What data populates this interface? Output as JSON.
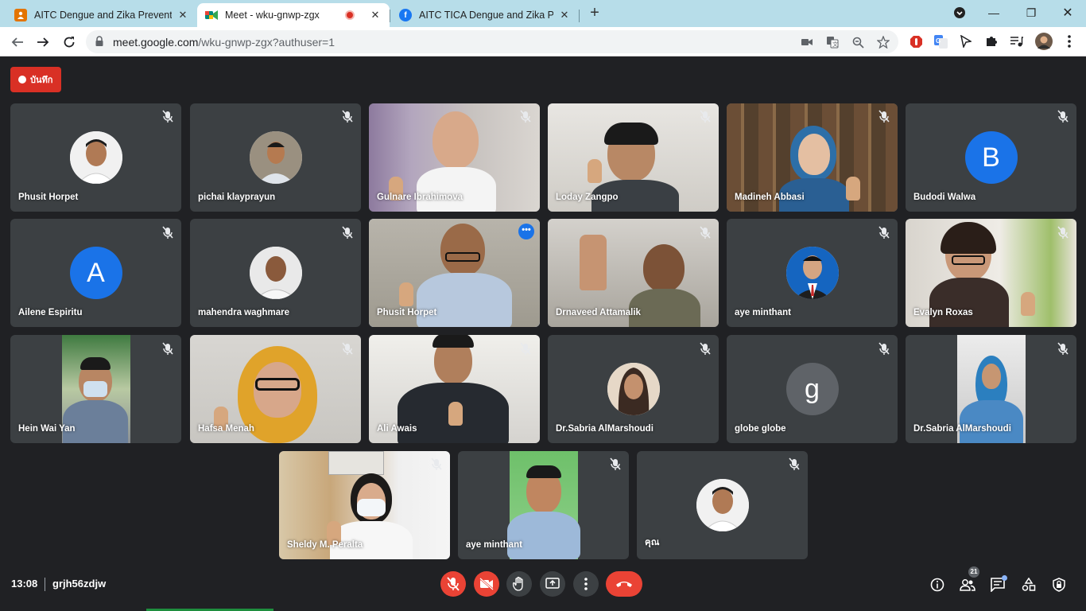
{
  "browser": {
    "tabs": [
      {
        "title": "AITC Dengue and Zika Prevention",
        "favicon": "person-icon",
        "color": "#e37400"
      },
      {
        "title": "Meet - wku-gnwp-zgx",
        "favicon": "meet-icon",
        "color": "#00897b",
        "recording": true
      },
      {
        "title": "AITC TICA Dengue and Zika Prev",
        "favicon": "facebook-icon",
        "color": "#1877f2"
      }
    ],
    "url_host": "meet.google.com",
    "url_path": "/wku-gnwp-zgx?authuser=1"
  },
  "meet": {
    "recording_label": "บันทึก",
    "tiles": [
      {
        "name": "Phusit Horpet",
        "kind": "avatar-photo"
      },
      {
        "name": "pichai klayprayun",
        "kind": "avatar-photo"
      },
      {
        "name": "Gulnare Ibrahimova",
        "kind": "video"
      },
      {
        "name": "Loday Zangpo",
        "kind": "video"
      },
      {
        "name": "Madineh Abbasi",
        "kind": "video"
      },
      {
        "name": "Budodi Walwa",
        "kind": "avatar-letter",
        "letter": "B",
        "color": "#1a73e8"
      },
      {
        "name": "Ailene Espiritu",
        "kind": "avatar-letter",
        "letter": "A",
        "color": "#1a73e8"
      },
      {
        "name": "mahendra waghmare",
        "kind": "avatar-photo"
      },
      {
        "name": "Phusit Horpet",
        "kind": "video",
        "speaking": true
      },
      {
        "name": "Drnaveed Attamalik",
        "kind": "video"
      },
      {
        "name": "aye minthant",
        "kind": "avatar-photo"
      },
      {
        "name": "Evalyn Roxas",
        "kind": "video"
      },
      {
        "name": "Hein Wai Yan",
        "kind": "video"
      },
      {
        "name": "Hafsa Menah",
        "kind": "video"
      },
      {
        "name": "Ali Awais",
        "kind": "video"
      },
      {
        "name": "Dr.Sabria AlMarshoudi",
        "kind": "avatar-photo"
      },
      {
        "name": "globe globe",
        "kind": "avatar-letter",
        "letter": "g",
        "color": "#5f6368"
      },
      {
        "name": "Dr.Sabria AlMarshoudi",
        "kind": "video"
      },
      {
        "name": "Sheldy M. Peralta",
        "kind": "video"
      },
      {
        "name": "aye minthant",
        "kind": "video"
      },
      {
        "name": "คุณ",
        "kind": "avatar-photo"
      }
    ]
  },
  "bottom": {
    "time": "13:08",
    "meeting_code": "grjh56zdjw",
    "participant_count": "21"
  },
  "colors": {
    "meet_bg": "#202124",
    "tile_bg": "#3c4043",
    "danger": "#ea4335",
    "accent": "#1a73e8",
    "tabstrip": "#b7dde9"
  }
}
